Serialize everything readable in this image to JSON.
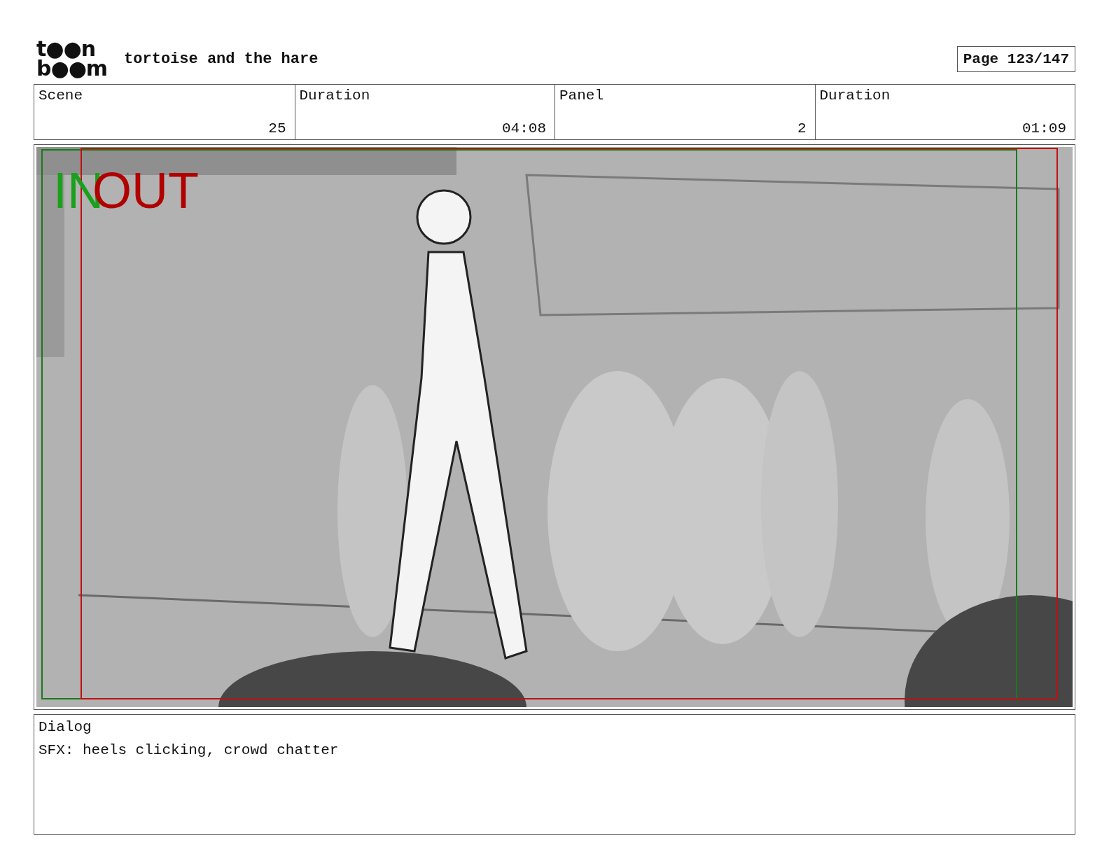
{
  "header": {
    "logo": [
      "t●●n",
      "b●●m"
    ],
    "title": "tortoise and the hare",
    "page": "Page 123/147"
  },
  "info": [
    {
      "label": "Scene",
      "value": "25"
    },
    {
      "label": "Duration",
      "value": "04:08"
    },
    {
      "label": "Panel",
      "value": "2"
    },
    {
      "label": "Duration",
      "value": "01:09"
    }
  ],
  "panel": {
    "markers": [
      {
        "kind": "in",
        "text": "IN"
      },
      {
        "kind": "out",
        "text": "OUT"
      }
    ]
  },
  "dialog": {
    "label": "Dialog",
    "text": "SFX: heels clicking, crowd chatter"
  }
}
